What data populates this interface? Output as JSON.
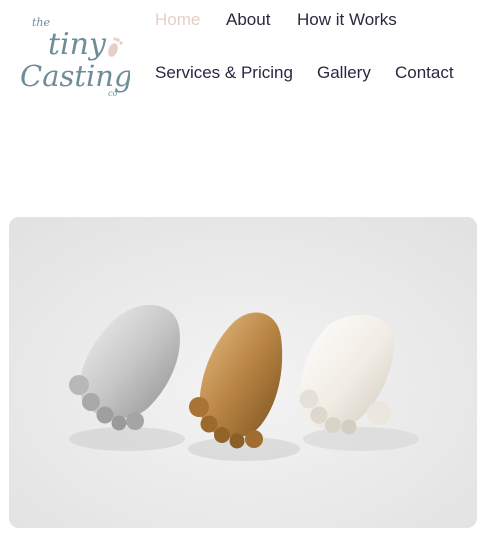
{
  "brand": {
    "logo_line1": "the",
    "logo_line2": "tiny",
    "logo_line3": "Casting",
    "logo_line4": "co",
    "accent_color": "#e6cfc9",
    "logo_color": "#6f8c99"
  },
  "nav": {
    "items": [
      {
        "label": "Home",
        "active": true
      },
      {
        "label": "About"
      },
      {
        "label": "How it Works"
      },
      {
        "label": "Services & Pricing"
      },
      {
        "label": "Gallery"
      },
      {
        "label": "Contact"
      }
    ],
    "text_color": "#2b2740"
  },
  "hero": {
    "image": "three-baby-foot-casts-silver-bronze-white"
  }
}
